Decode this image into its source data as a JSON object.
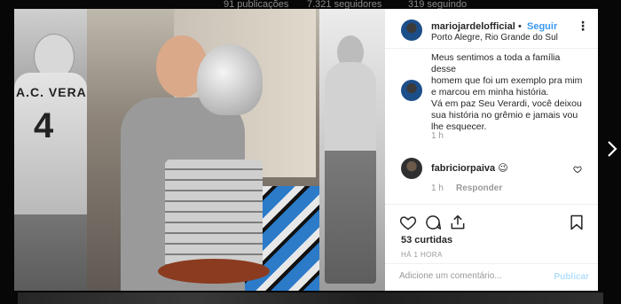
{
  "background": {
    "posts_count_label": "91 publicações",
    "followers_label": "7.321 seguidores",
    "following_label": "319 seguindo"
  },
  "post": {
    "author": {
      "username": "mariojardelofficial",
      "follow_label": "Seguir",
      "separator": "•",
      "location": "Porto Alegre, Rio Grande do Sul"
    },
    "photo": {
      "jersey_name": "A.C. VERARDI",
      "jersey_number": "4"
    },
    "caption": {
      "lines": [
        "Meus sentimos a toda a família desse",
        "homem que foi um exemplo pra mim",
        "e marcou em minha história.",
        "Vá em paz Seu Verardi, você deixou",
        "sua história no grêmio e jamais vou",
        "lhe esquecer."
      ],
      "time": "1 h"
    },
    "comments": [
      {
        "username": "fabriciorpaiva",
        "text": "😉",
        "time": "1 h",
        "reply_label": "Responder"
      }
    ],
    "likes_label": "53 curtidas",
    "posted_time": "HÁ 1 HORA",
    "comment_input": {
      "placeholder": "Adicione um comentário...",
      "value": ""
    },
    "publish_label": "Publicar"
  },
  "icons": {
    "more": "more-options-icon",
    "heart": "heart-icon",
    "comment": "comment-icon",
    "share": "share-icon",
    "save": "bookmark-icon",
    "next": "chevron-right-icon"
  },
  "colors": {
    "accent": "#3897f0",
    "publish_disabled": "#b2dffc",
    "muted_text": "#999999"
  }
}
